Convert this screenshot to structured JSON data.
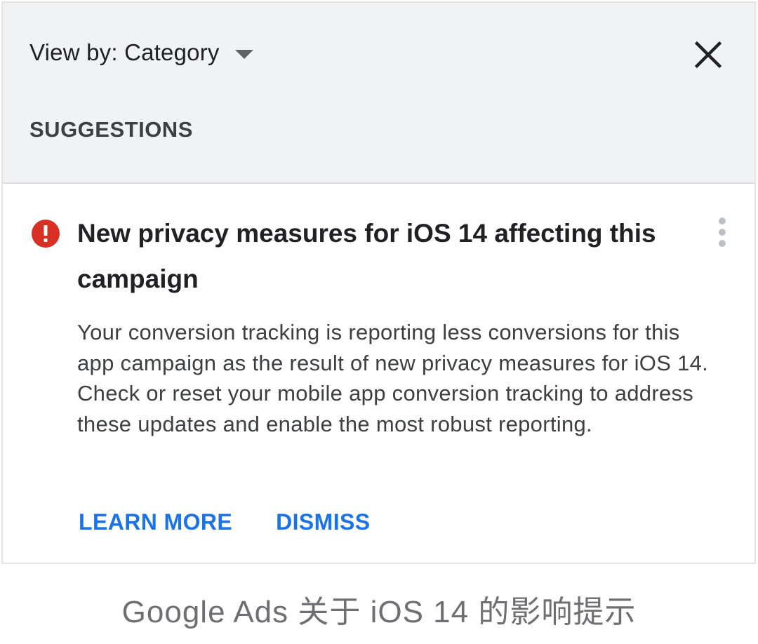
{
  "header": {
    "view_by_label": "View by: Category",
    "section_label": "SUGGESTIONS"
  },
  "card": {
    "title": "New privacy measures for iOS 14 affecting this campaign",
    "body": "Your conversion tracking is reporting less conversions for this app campaign as the result of new privacy measures for iOS 14. Check or reset your mobile app conversion tracking to address these updates and enable the most robust reporting.",
    "actions": {
      "learn_more": "LEARN MORE",
      "dismiss": "DISMISS"
    }
  },
  "caption": "Google Ads 关于 iOS 14 的影响提示",
  "icons": {
    "view_by_dropdown": "caret-down-icon",
    "close": "close-icon",
    "alert": "error-alert-icon",
    "more": "more-vertical-icon"
  },
  "colors": {
    "header_bg": "#f1f2f4",
    "alert_red": "#d93025",
    "action_blue": "#1a73e8",
    "title_text": "#202124",
    "body_text": "#3c4043",
    "caption_text": "#6e6e73"
  }
}
